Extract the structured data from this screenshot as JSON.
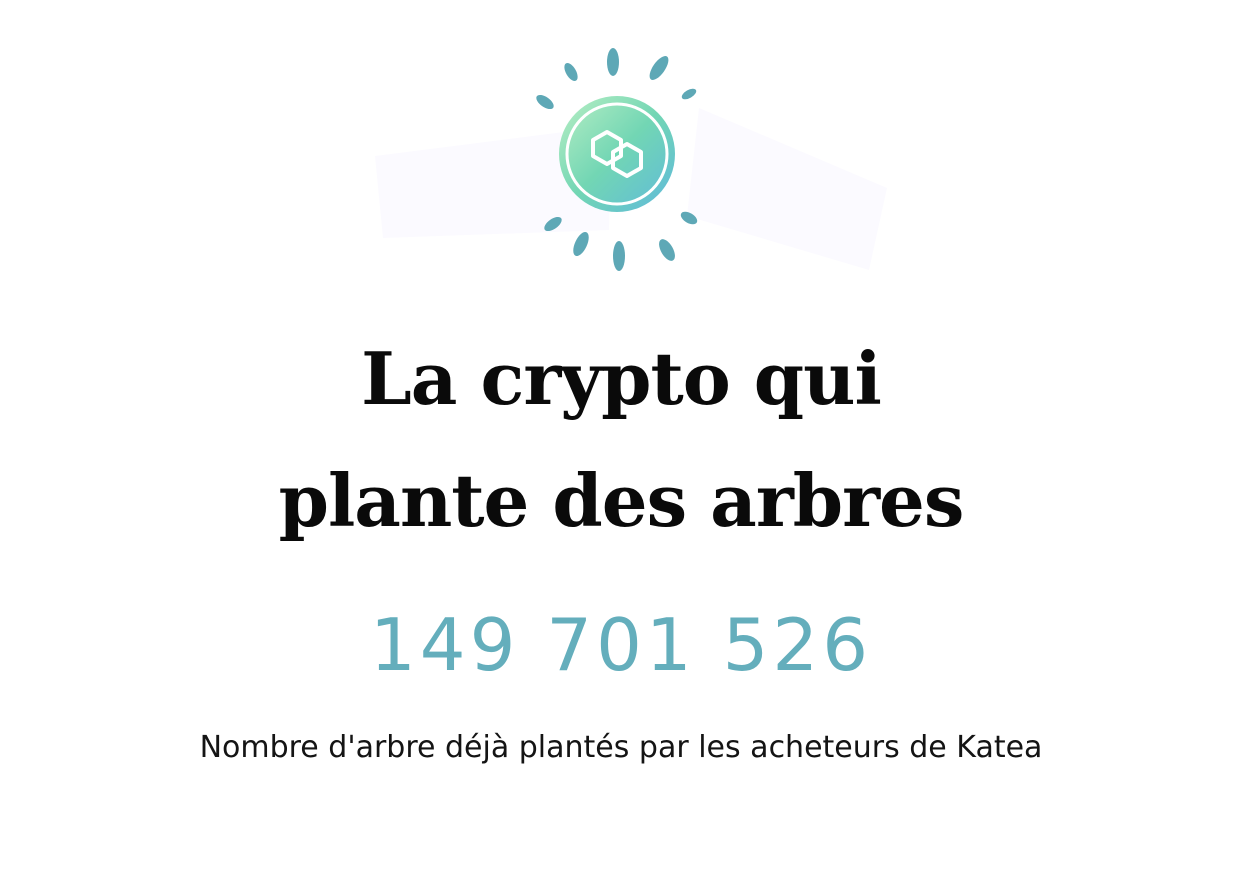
{
  "logo": {
    "icon": "katea-sun-leaf-logo",
    "colors": {
      "leaf": "#5ea8b6",
      "coin_light": "#b6ecc6",
      "coin_mid": "#6fd3b2",
      "coin_blue": "#64bcd8",
      "backdrop": "#fbfaff"
    }
  },
  "headline": {
    "line1": "La crypto qui",
    "line2": "plante des arbres"
  },
  "counter": {
    "value": "149 701 526",
    "color": "#64aebc"
  },
  "caption": {
    "text": "Nombre d'arbre déjà plantés par les acheteurs de Katea"
  }
}
